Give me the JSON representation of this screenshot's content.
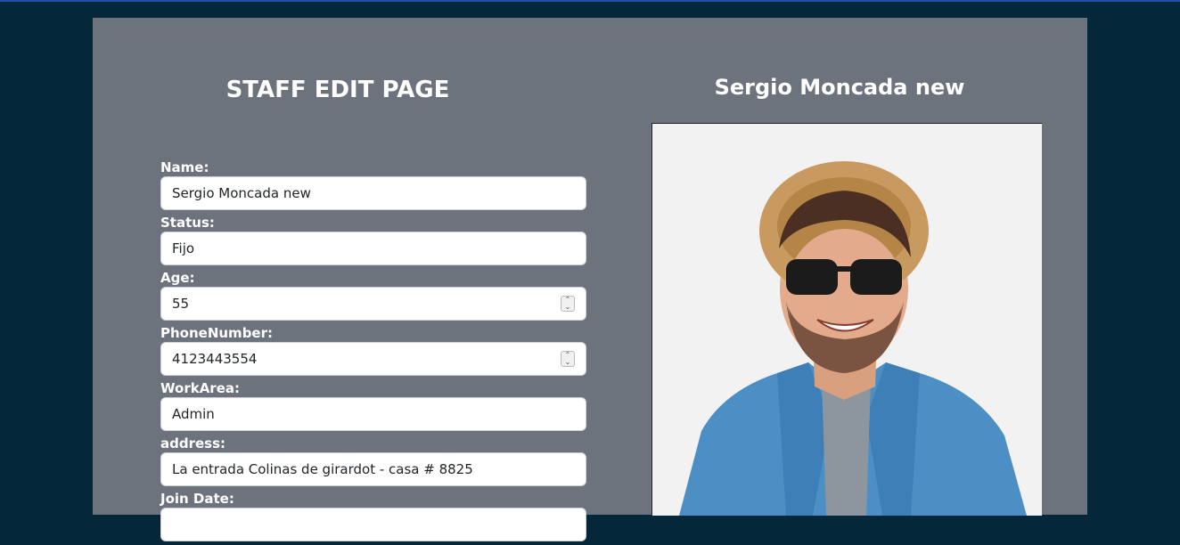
{
  "form": {
    "title": "STAFF EDIT PAGE",
    "fields": [
      {
        "label": "Name:",
        "value": "Sergio Moncada new",
        "type": "text"
      },
      {
        "label": "Status:",
        "value": "Fijo",
        "type": "text"
      },
      {
        "label": "Age:",
        "value": "55",
        "type": "number"
      },
      {
        "label": "PhoneNumber:",
        "value": "4123443554",
        "type": "number"
      },
      {
        "label": "WorkArea:",
        "value": "Admin",
        "type": "text"
      },
      {
        "label": "address:",
        "value": "La entrada Colinas de girardot - casa # 8825",
        "type": "text"
      },
      {
        "label": "Join Date:",
        "value": "",
        "type": "date"
      }
    ]
  },
  "profile": {
    "name": "Sergio Moncada new",
    "photo_icon": "staff-photo"
  },
  "colors": {
    "background": "#04283a",
    "panel": "#6c737c",
    "accent_line": "#1f4fa8"
  }
}
